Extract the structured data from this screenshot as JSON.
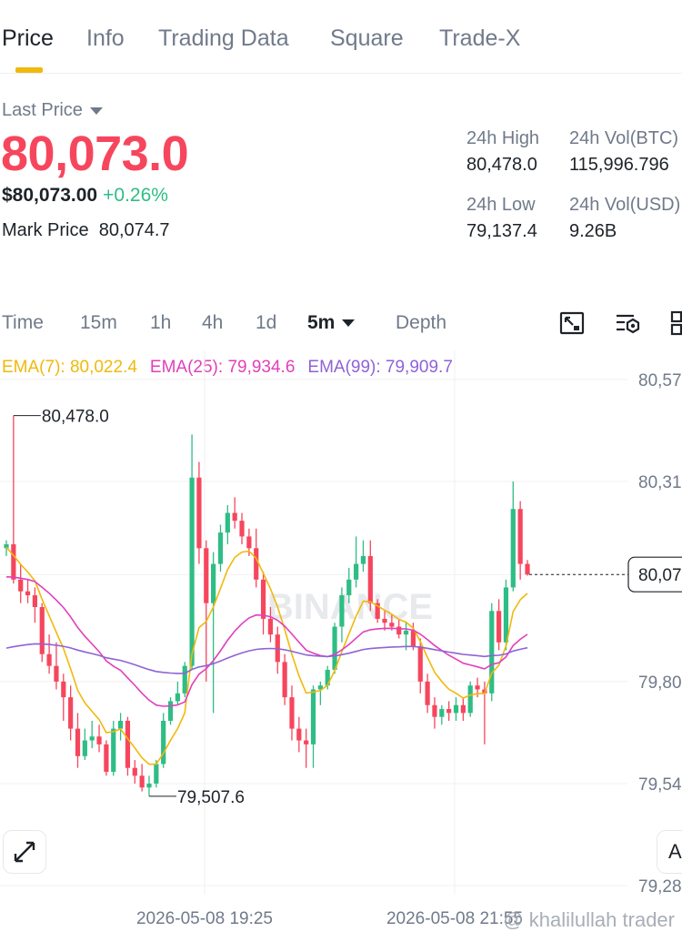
{
  "tabs": [
    {
      "label": "Price",
      "active": true
    },
    {
      "label": "Info"
    },
    {
      "label": "Trading Data"
    },
    {
      "label": "Square"
    },
    {
      "label": "Trade-X"
    }
  ],
  "price": {
    "last_price_label": "Last Price",
    "last_price": "80,073.0",
    "usd_price": "$80,073.00",
    "change_pct": "+0.26%",
    "mark_price_label": "Mark Price",
    "mark_price": "80,074.7"
  },
  "stats": {
    "high_label": "24h High",
    "high": "80,478.0",
    "low_label": "24h Low",
    "low": "79,137.4",
    "vol_btc_label": "24h Vol(BTC)",
    "vol_btc": "115,996.796",
    "vol_usd_label": "24h Vol(USD)",
    "vol_usd": "9.26B"
  },
  "intervals": {
    "time": "Time",
    "m15": "15m",
    "h1": "1h",
    "h4": "4h",
    "d1": "1d",
    "selected": "5m",
    "depth": "Depth"
  },
  "ema": {
    "ema7": "EMA(7): 80,022.4",
    "ema25": "EMA(25): 79,934.6",
    "ema99": "EMA(99): 79,909.7"
  },
  "colors": {
    "up": "#2ebd85",
    "down": "#f6465d",
    "accent": "#f0b90b",
    "ema7": "#f0b90b",
    "ema25": "#e23fbb",
    "ema99": "#8e63d6"
  },
  "watermark_text": "BINANCE",
  "overlay_text": "@ khalilullah trader",
  "chart_data": {
    "type": "candlestick",
    "y_ticks": [
      "80,57",
      "80,31",
      "80,07",
      "79,80",
      "79,54",
      "79,28"
    ],
    "y_tick_values": [
      80570,
      80310,
      80073,
      79800,
      79540,
      79280
    ],
    "x_labels": [
      "2026-05-08 19:25",
      "2026-05-08 21:55"
    ],
    "current_price_tag": "80,07",
    "current_price": 80073,
    "max_label": "80,478.0",
    "max_value": 80478,
    "min_label": "79,507.6",
    "min_value": 79507.6,
    "candles": [
      {
        "o": 80140,
        "h": 80160,
        "l": 80120,
        "c": 80150
      },
      {
        "o": 80150,
        "h": 80478,
        "l": 80050,
        "c": 80060
      },
      {
        "o": 80060,
        "h": 80100,
        "l": 80000,
        "c": 80030
      },
      {
        "o": 80030,
        "h": 80060,
        "l": 80000,
        "c": 80020
      },
      {
        "o": 80020,
        "h": 80040,
        "l": 79950,
        "c": 79990
      },
      {
        "o": 79990,
        "h": 80000,
        "l": 79850,
        "c": 79870
      },
      {
        "o": 79870,
        "h": 79920,
        "l": 79820,
        "c": 79840
      },
      {
        "o": 79840,
        "h": 79900,
        "l": 79780,
        "c": 79800
      },
      {
        "o": 79800,
        "h": 79820,
        "l": 79700,
        "c": 79760
      },
      {
        "o": 79760,
        "h": 79790,
        "l": 79650,
        "c": 79680
      },
      {
        "o": 79680,
        "h": 79720,
        "l": 79580,
        "c": 79610
      },
      {
        "o": 79610,
        "h": 79680,
        "l": 79600,
        "c": 79650
      },
      {
        "o": 79650,
        "h": 79700,
        "l": 79630,
        "c": 79660
      },
      {
        "o": 79660,
        "h": 79690,
        "l": 79620,
        "c": 79640
      },
      {
        "o": 79640,
        "h": 79650,
        "l": 79560,
        "c": 79570
      },
      {
        "o": 79570,
        "h": 79700,
        "l": 79560,
        "c": 79680
      },
      {
        "o": 79680,
        "h": 79720,
        "l": 79650,
        "c": 79700
      },
      {
        "o": 79700,
        "h": 79710,
        "l": 79560,
        "c": 79580
      },
      {
        "o": 79580,
        "h": 79600,
        "l": 79540,
        "c": 79560
      },
      {
        "o": 79560,
        "h": 79590,
        "l": 79520,
        "c": 79530
      },
      {
        "o": 79530,
        "h": 79560,
        "l": 79507.6,
        "c": 79540
      },
      {
        "o": 79540,
        "h": 79600,
        "l": 79530,
        "c": 79590
      },
      {
        "o": 79590,
        "h": 79720,
        "l": 79580,
        "c": 79700
      },
      {
        "o": 79700,
        "h": 79760,
        "l": 79690,
        "c": 79750
      },
      {
        "o": 79750,
        "h": 79800,
        "l": 79740,
        "c": 79770
      },
      {
        "o": 79770,
        "h": 79850,
        "l": 79760,
        "c": 79840
      },
      {
        "o": 79840,
        "h": 80430,
        "l": 79830,
        "c": 80320
      },
      {
        "o": 80320,
        "h": 80360,
        "l": 80100,
        "c": 80140
      },
      {
        "o": 80140,
        "h": 80160,
        "l": 79800,
        "c": 80000
      },
      {
        "o": 80000,
        "h": 80130,
        "l": 79720,
        "c": 80100
      },
      {
        "o": 80100,
        "h": 80200,
        "l": 80080,
        "c": 80180
      },
      {
        "o": 80180,
        "h": 80250,
        "l": 80150,
        "c": 80230
      },
      {
        "o": 80230,
        "h": 80270,
        "l": 80190,
        "c": 80210
      },
      {
        "o": 80210,
        "h": 80230,
        "l": 80150,
        "c": 80170
      },
      {
        "o": 80170,
        "h": 80190,
        "l": 80120,
        "c": 80140
      },
      {
        "o": 80140,
        "h": 80190,
        "l": 80040,
        "c": 80060
      },
      {
        "o": 80060,
        "h": 80080,
        "l": 79920,
        "c": 79960
      },
      {
        "o": 79960,
        "h": 79990,
        "l": 79900,
        "c": 79920
      },
      {
        "o": 79920,
        "h": 79940,
        "l": 79820,
        "c": 79850
      },
      {
        "o": 79850,
        "h": 79870,
        "l": 79740,
        "c": 79760
      },
      {
        "o": 79760,
        "h": 79790,
        "l": 79650,
        "c": 79680
      },
      {
        "o": 79680,
        "h": 79710,
        "l": 79620,
        "c": 79650
      },
      {
        "o": 79650,
        "h": 79680,
        "l": 79580,
        "c": 79640
      },
      {
        "o": 79640,
        "h": 79790,
        "l": 79580,
        "c": 79780
      },
      {
        "o": 79780,
        "h": 79800,
        "l": 79740,
        "c": 79790
      },
      {
        "o": 79790,
        "h": 79840,
        "l": 79780,
        "c": 79830
      },
      {
        "o": 79830,
        "h": 79950,
        "l": 79820,
        "c": 79940
      },
      {
        "o": 79940,
        "h": 80040,
        "l": 79900,
        "c": 80020
      },
      {
        "o": 80020,
        "h": 80090,
        "l": 80000,
        "c": 80060
      },
      {
        "o": 80060,
        "h": 80170,
        "l": 80040,
        "c": 80100
      },
      {
        "o": 80100,
        "h": 80160,
        "l": 80080,
        "c": 80120
      },
      {
        "o": 80120,
        "h": 80160,
        "l": 79980,
        "c": 80000
      },
      {
        "o": 80000,
        "h": 80010,
        "l": 79950,
        "c": 79960
      },
      {
        "o": 79960,
        "h": 79980,
        "l": 79930,
        "c": 79950
      },
      {
        "o": 79950,
        "h": 79970,
        "l": 79930,
        "c": 79940
      },
      {
        "o": 79940,
        "h": 79960,
        "l": 79910,
        "c": 79920
      },
      {
        "o": 79920,
        "h": 79950,
        "l": 79880,
        "c": 79930
      },
      {
        "o": 79930,
        "h": 79950,
        "l": 79880,
        "c": 79890
      },
      {
        "o": 79890,
        "h": 79910,
        "l": 79770,
        "c": 79800
      },
      {
        "o": 79800,
        "h": 79820,
        "l": 79720,
        "c": 79740
      },
      {
        "o": 79740,
        "h": 79760,
        "l": 79680,
        "c": 79710
      },
      {
        "o": 79710,
        "h": 79740,
        "l": 79690,
        "c": 79730
      },
      {
        "o": 79730,
        "h": 79750,
        "l": 79700,
        "c": 79720
      },
      {
        "o": 79720,
        "h": 79760,
        "l": 79700,
        "c": 79740
      },
      {
        "o": 79740,
        "h": 79760,
        "l": 79700,
        "c": 79720
      },
      {
        "o": 79720,
        "h": 79800,
        "l": 79710,
        "c": 79790
      },
      {
        "o": 79790,
        "h": 79810,
        "l": 79760,
        "c": 79780
      },
      {
        "o": 79780,
        "h": 79800,
        "l": 79640,
        "c": 79770
      },
      {
        "o": 79770,
        "h": 80000,
        "l": 79750,
        "c": 79980
      },
      {
        "o": 79980,
        "h": 80010,
        "l": 79880,
        "c": 79900
      },
      {
        "o": 79900,
        "h": 80060,
        "l": 79880,
        "c": 80040
      },
      {
        "o": 80040,
        "h": 80310,
        "l": 80030,
        "c": 80240
      },
      {
        "o": 80240,
        "h": 80260,
        "l": 80060,
        "c": 80100
      },
      {
        "o": 80100,
        "h": 80110,
        "l": 80070,
        "c": 80073
      }
    ]
  }
}
